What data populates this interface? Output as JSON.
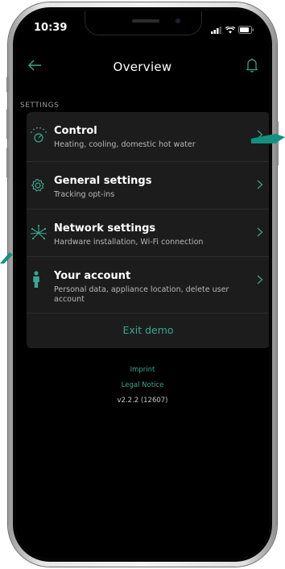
{
  "status_bar": {
    "time": "10:39"
  },
  "header": {
    "title": "Overview"
  },
  "section_label": "SETTINGS",
  "items": [
    {
      "label": "Control",
      "sub": "Heating, cooling, domestic hot water"
    },
    {
      "label": "General settings",
      "sub": "Tracking opt-ins"
    },
    {
      "label": "Network settings",
      "sub": "Hardware installation, Wi-Fi connection"
    },
    {
      "label": "Your account",
      "sub": "Personal data, appliance location, delete user account"
    }
  ],
  "exit_label": "Exit demo",
  "footer": {
    "imprint": "Imprint",
    "legal": "Legal Notice",
    "version": "v2.2.2 (12607)"
  },
  "colors": {
    "accent": "#37a98f",
    "card_bg": "#1c1c1c",
    "screen_bg": "#000000"
  },
  "icons": {
    "back": "arrow-left-icon",
    "bell": "bell-icon",
    "control": "control-dial-icon",
    "general": "gear-icon",
    "network": "network-icon",
    "account": "person-icon"
  }
}
